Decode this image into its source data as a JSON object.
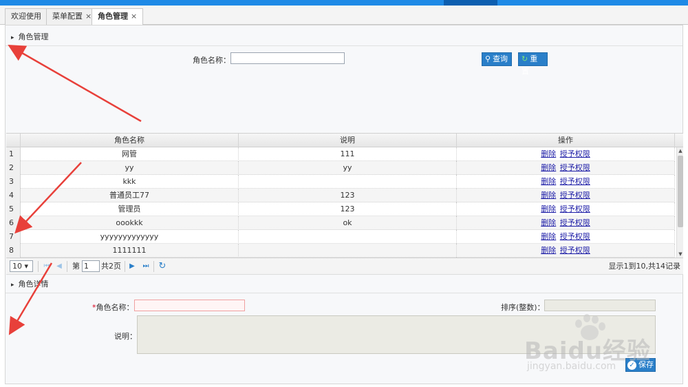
{
  "tabs": [
    {
      "label": "欢迎使用",
      "closable": false
    },
    {
      "label": "菜单配置",
      "closable": true
    },
    {
      "label": "角色管理",
      "closable": true,
      "active": true
    }
  ],
  "close_glyph": "×",
  "role_panel": {
    "title": "角色管理",
    "search_label": "角色名称：",
    "search_value": "",
    "query_button": "查询",
    "reset_button": "重置"
  },
  "grid": {
    "columns": [
      "角色名称",
      "说明",
      "操作"
    ],
    "delete_label": "删除",
    "grant_label": "授予权限",
    "rows": [
      {
        "no": "1",
        "name": "网管",
        "desc": "111"
      },
      {
        "no": "2",
        "name": "yy",
        "desc": "yy"
      },
      {
        "no": "3",
        "name": "kkk",
        "desc": ""
      },
      {
        "no": "4",
        "name": "普通员工77",
        "desc": "123"
      },
      {
        "no": "5",
        "name": "管理员",
        "desc": "123"
      },
      {
        "no": "6",
        "name": "oookkk",
        "desc": "ok"
      },
      {
        "no": "7",
        "name": "yyyyyyyyyyyyy",
        "desc": ""
      },
      {
        "no": "8",
        "name": "1111111",
        "desc": ""
      }
    ]
  },
  "pager": {
    "page_size": "10",
    "page_prefix": "第",
    "page_value": "1",
    "page_suffix": "共2页",
    "summary": "显示1到10,共14记录"
  },
  "detail_panel": {
    "title": "角色详情",
    "required_mark": "*",
    "name_label": "角色名称：",
    "order_label": "排序(整数)：",
    "desc_label": "说明：",
    "save_button": "保存"
  },
  "watermark": {
    "brand": "Baidu经验",
    "domain": "jingyan.baidu.com"
  },
  "colors": {
    "accent": "#1e8ae6",
    "button": "#2a7fc9",
    "arrow": "#e8403a",
    "link": "#1a1aa6"
  }
}
